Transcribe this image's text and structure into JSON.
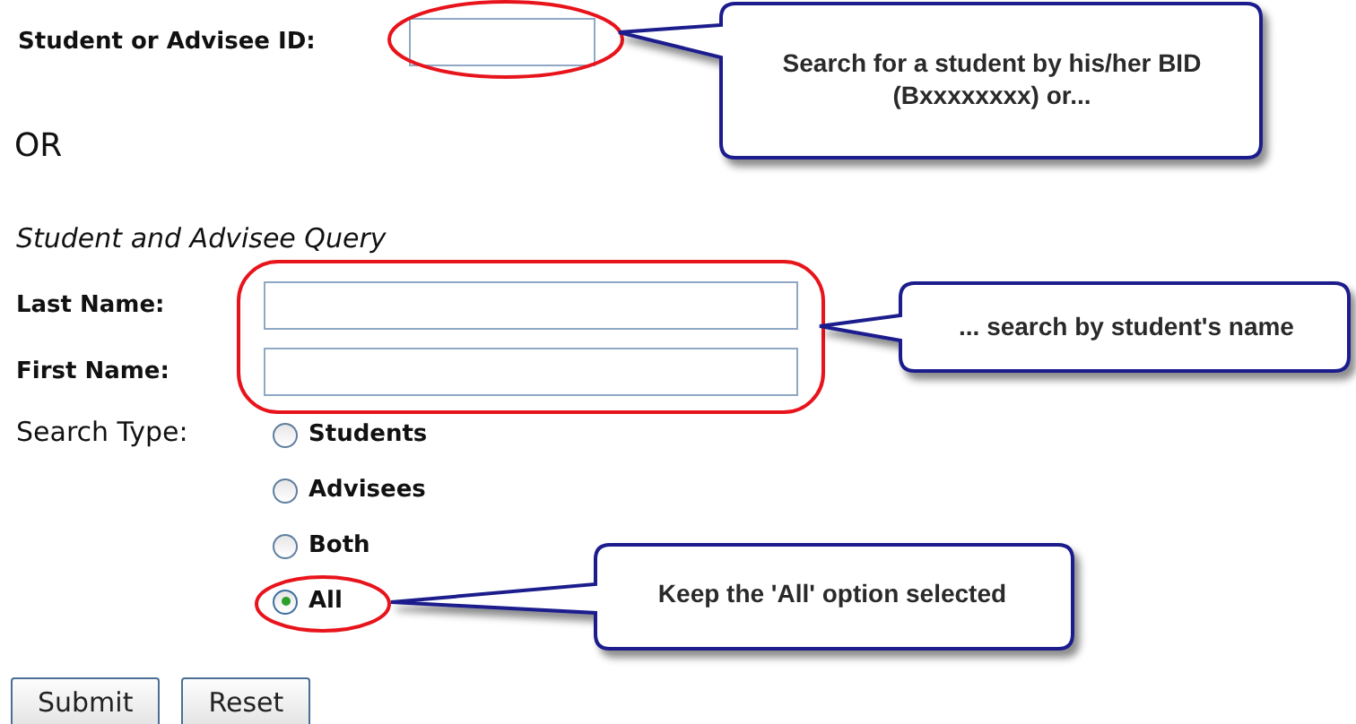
{
  "id_search": {
    "label": "Student or Advisee ID:"
  },
  "or_text": "OR",
  "query": {
    "title": "Student and Advisee Query",
    "fields": [
      {
        "label": "Last Name:"
      },
      {
        "label": "First Name:"
      }
    ],
    "search_type": {
      "label": "Search Type:",
      "options": [
        {
          "label": "Students",
          "selected": false
        },
        {
          "label": "Advisees",
          "selected": false
        },
        {
          "label": "Both",
          "selected": false
        },
        {
          "label": "All",
          "selected": true
        }
      ]
    }
  },
  "buttons": [
    "Submit",
    "Reset"
  ],
  "callouts": [
    {
      "text": "Search for a student by his/her BID (Bxxxxxxxx) or..."
    },
    {
      "text": "... search by student's name"
    },
    {
      "text": "Keep the 'All' option selected"
    }
  ]
}
